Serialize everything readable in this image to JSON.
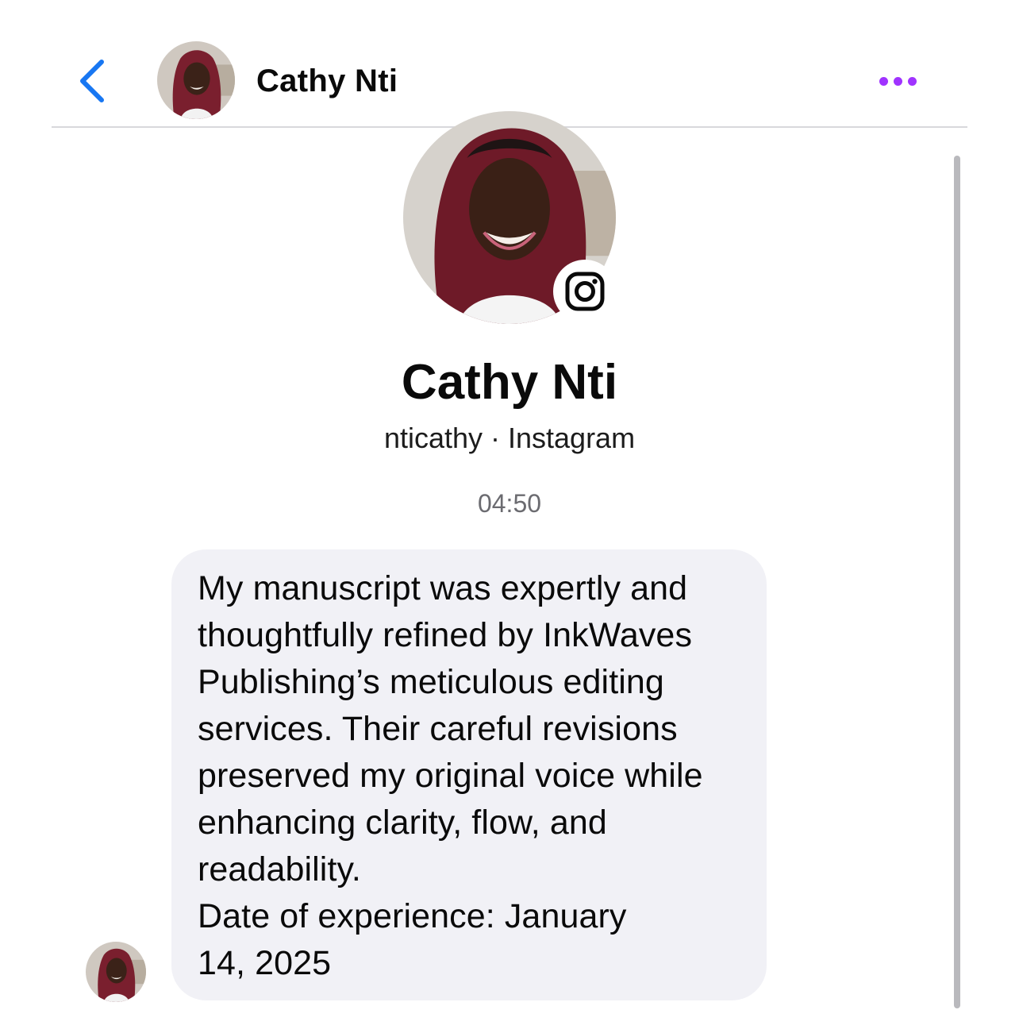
{
  "header": {
    "back_icon": "chevron-left-icon",
    "title": "Cathy Nti",
    "more_icon": "more-horizontal-icon",
    "accent_color": "#1877f2",
    "more_color": "#a033ff"
  },
  "profile": {
    "name": "Cathy Nti",
    "subtitle": "nticathy · Instagram",
    "badge_icon": "instagram-icon"
  },
  "conversation": {
    "timestamp": "04:50",
    "messages": [
      {
        "sender": "Cathy Nti",
        "text": "My manuscript was expertly and\nthoughtfully refined by InkWaves\nPublishing’s meticulous editing\nservices. Their careful revisions\npreserved my original voice while\nenhancing clarity, flow, and\nreadability.\nDate of experience: January\n14, 2025"
      }
    ]
  }
}
